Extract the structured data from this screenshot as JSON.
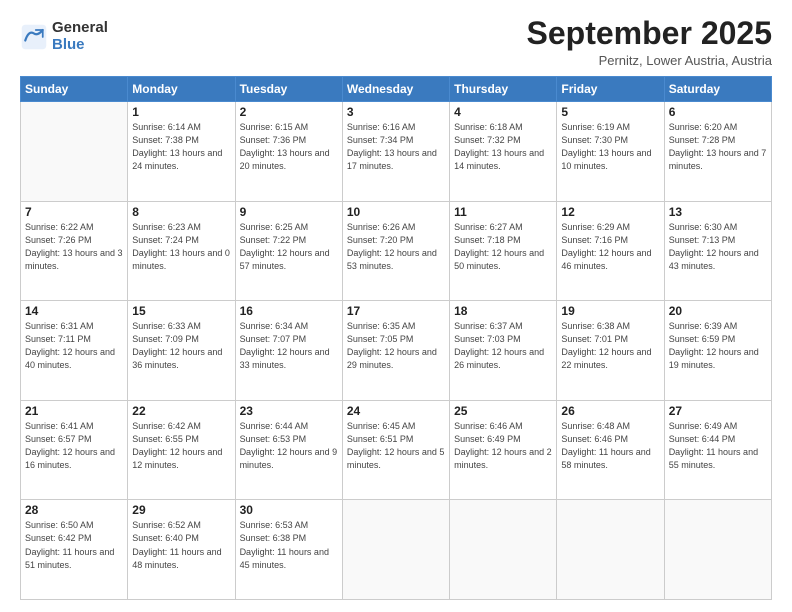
{
  "logo": {
    "line1": "General",
    "line2": "Blue"
  },
  "title": "September 2025",
  "subtitle": "Pernitz, Lower Austria, Austria",
  "days_of_week": [
    "Sunday",
    "Monday",
    "Tuesday",
    "Wednesday",
    "Thursday",
    "Friday",
    "Saturday"
  ],
  "weeks": [
    [
      {
        "day": "",
        "info": ""
      },
      {
        "day": "1",
        "info": "Sunrise: 6:14 AM\nSunset: 7:38 PM\nDaylight: 13 hours\nand 24 minutes."
      },
      {
        "day": "2",
        "info": "Sunrise: 6:15 AM\nSunset: 7:36 PM\nDaylight: 13 hours\nand 20 minutes."
      },
      {
        "day": "3",
        "info": "Sunrise: 6:16 AM\nSunset: 7:34 PM\nDaylight: 13 hours\nand 17 minutes."
      },
      {
        "day": "4",
        "info": "Sunrise: 6:18 AM\nSunset: 7:32 PM\nDaylight: 13 hours\nand 14 minutes."
      },
      {
        "day": "5",
        "info": "Sunrise: 6:19 AM\nSunset: 7:30 PM\nDaylight: 13 hours\nand 10 minutes."
      },
      {
        "day": "6",
        "info": "Sunrise: 6:20 AM\nSunset: 7:28 PM\nDaylight: 13 hours\nand 7 minutes."
      }
    ],
    [
      {
        "day": "7",
        "info": "Sunrise: 6:22 AM\nSunset: 7:26 PM\nDaylight: 13 hours\nand 3 minutes."
      },
      {
        "day": "8",
        "info": "Sunrise: 6:23 AM\nSunset: 7:24 PM\nDaylight: 13 hours\nand 0 minutes."
      },
      {
        "day": "9",
        "info": "Sunrise: 6:25 AM\nSunset: 7:22 PM\nDaylight: 12 hours\nand 57 minutes."
      },
      {
        "day": "10",
        "info": "Sunrise: 6:26 AM\nSunset: 7:20 PM\nDaylight: 12 hours\nand 53 minutes."
      },
      {
        "day": "11",
        "info": "Sunrise: 6:27 AM\nSunset: 7:18 PM\nDaylight: 12 hours\nand 50 minutes."
      },
      {
        "day": "12",
        "info": "Sunrise: 6:29 AM\nSunset: 7:16 PM\nDaylight: 12 hours\nand 46 minutes."
      },
      {
        "day": "13",
        "info": "Sunrise: 6:30 AM\nSunset: 7:13 PM\nDaylight: 12 hours\nand 43 minutes."
      }
    ],
    [
      {
        "day": "14",
        "info": "Sunrise: 6:31 AM\nSunset: 7:11 PM\nDaylight: 12 hours\nand 40 minutes."
      },
      {
        "day": "15",
        "info": "Sunrise: 6:33 AM\nSunset: 7:09 PM\nDaylight: 12 hours\nand 36 minutes."
      },
      {
        "day": "16",
        "info": "Sunrise: 6:34 AM\nSunset: 7:07 PM\nDaylight: 12 hours\nand 33 minutes."
      },
      {
        "day": "17",
        "info": "Sunrise: 6:35 AM\nSunset: 7:05 PM\nDaylight: 12 hours\nand 29 minutes."
      },
      {
        "day": "18",
        "info": "Sunrise: 6:37 AM\nSunset: 7:03 PM\nDaylight: 12 hours\nand 26 minutes."
      },
      {
        "day": "19",
        "info": "Sunrise: 6:38 AM\nSunset: 7:01 PM\nDaylight: 12 hours\nand 22 minutes."
      },
      {
        "day": "20",
        "info": "Sunrise: 6:39 AM\nSunset: 6:59 PM\nDaylight: 12 hours\nand 19 minutes."
      }
    ],
    [
      {
        "day": "21",
        "info": "Sunrise: 6:41 AM\nSunset: 6:57 PM\nDaylight: 12 hours\nand 16 minutes."
      },
      {
        "day": "22",
        "info": "Sunrise: 6:42 AM\nSunset: 6:55 PM\nDaylight: 12 hours\nand 12 minutes."
      },
      {
        "day": "23",
        "info": "Sunrise: 6:44 AM\nSunset: 6:53 PM\nDaylight: 12 hours\nand 9 minutes."
      },
      {
        "day": "24",
        "info": "Sunrise: 6:45 AM\nSunset: 6:51 PM\nDaylight: 12 hours\nand 5 minutes."
      },
      {
        "day": "25",
        "info": "Sunrise: 6:46 AM\nSunset: 6:49 PM\nDaylight: 12 hours\nand 2 minutes."
      },
      {
        "day": "26",
        "info": "Sunrise: 6:48 AM\nSunset: 6:46 PM\nDaylight: 11 hours\nand 58 minutes."
      },
      {
        "day": "27",
        "info": "Sunrise: 6:49 AM\nSunset: 6:44 PM\nDaylight: 11 hours\nand 55 minutes."
      }
    ],
    [
      {
        "day": "28",
        "info": "Sunrise: 6:50 AM\nSunset: 6:42 PM\nDaylight: 11 hours\nand 51 minutes."
      },
      {
        "day": "29",
        "info": "Sunrise: 6:52 AM\nSunset: 6:40 PM\nDaylight: 11 hours\nand 48 minutes."
      },
      {
        "day": "30",
        "info": "Sunrise: 6:53 AM\nSunset: 6:38 PM\nDaylight: 11 hours\nand 45 minutes."
      },
      {
        "day": "",
        "info": ""
      },
      {
        "day": "",
        "info": ""
      },
      {
        "day": "",
        "info": ""
      },
      {
        "day": "",
        "info": ""
      }
    ]
  ]
}
